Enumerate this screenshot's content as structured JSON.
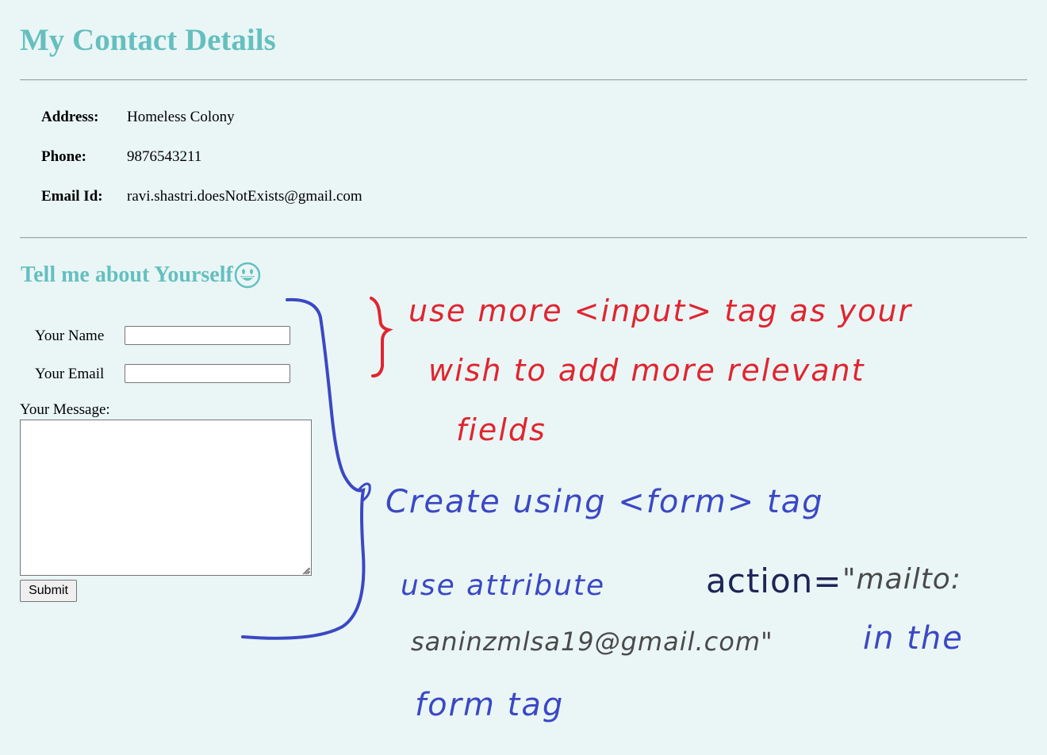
{
  "page_title": "My Contact Details",
  "contact": {
    "rows": [
      {
        "label": "Address:",
        "value": "Homeless Colony"
      },
      {
        "label": "Phone:",
        "value": "9876543211"
      },
      {
        "label": "Email Id:",
        "value": "ravi.shastri.doesNotExists@gmail.com"
      }
    ]
  },
  "form_section": {
    "title": "Tell me about Yourself",
    "title_icon": "grinning-face-icon",
    "name_label": "Your Name",
    "name_value": "",
    "email_label": "Your Email",
    "email_value": "",
    "message_label": "Your Message:",
    "message_value": "",
    "submit_label": "Submit"
  },
  "annotations": {
    "red_line1": "use more <input> tag as your",
    "red_line2": "wish to add more relevant",
    "red_line3": "fields",
    "blue_line1": "Create using <form> tag",
    "blue_line2": "use attribute",
    "navy_text": "action=",
    "grey_line1": "\"mailto:",
    "grey_line2": "saninzmlsa19@gmail.com\"",
    "blue_line3": "in the",
    "blue_line4": "form tag"
  },
  "colors": {
    "background": "#eaf6f6",
    "heading": "#66bfbf",
    "annotation_red": "#e02530",
    "annotation_blue": "#3b48c4",
    "annotation_navy": "#1d2457",
    "annotation_grey": "#4a4a4a"
  }
}
